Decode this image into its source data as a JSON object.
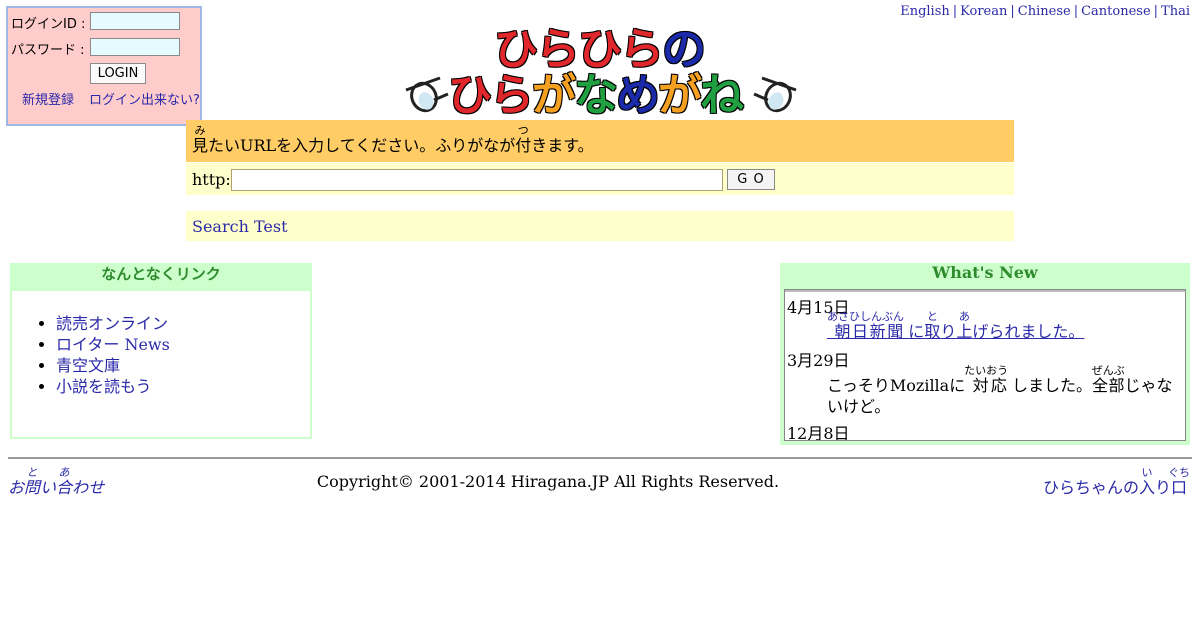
{
  "login": {
    "id_label": "ログインID :",
    "password_label": "パスワード :",
    "button_label": "LOGIN",
    "register_link": "新規登録",
    "forgot_link": "ログイン出来ない?"
  },
  "languages": [
    "English",
    "Korean",
    "Chinese",
    "Cantonese",
    "Thai"
  ],
  "logo": {
    "line1": "ひらひらの",
    "line2": "ひらがなめがね"
  },
  "url_panel": {
    "instruction_pre": "たいURLを入力してください。ふりがなが",
    "instruction_kanji1": "見",
    "instruction_ruby1": "み",
    "instruction_kanji2": "付",
    "instruction_ruby2": "つ",
    "instruction_post": "きます。",
    "prefix": "http://",
    "url_value": "",
    "go_label": "G O",
    "search_link": "Search Test"
  },
  "links_box": {
    "title": "なんとなくリンク",
    "items": [
      "読売オンライン",
      "ロイター News",
      "青空文庫",
      "小説を読もう"
    ]
  },
  "whats_new": {
    "title": "What's New",
    "entries": [
      {
        "date": "4月15日",
        "text_kanji1": "朝日新聞",
        "ruby1": "あさひしんぶん",
        "text_mid": "に",
        "text_kanji2": "取",
        "ruby2": "と",
        "text_mid2": "り",
        "text_kanji3": "上",
        "ruby3": "あ",
        "text_post": "げられました。"
      },
      {
        "date": "3月29日",
        "text_pre": "こっそりMozillaに",
        "text_kanji1": "対応",
        "ruby1": "たいおう",
        "text_mid": "しました。",
        "text_kanji2": "全部",
        "ruby2": "ぜんぶ",
        "text_post": "じゃないけど。"
      },
      {
        "date": "12月8日"
      }
    ]
  },
  "footer": {
    "contact_pre": "お",
    "contact_kanji1": "問",
    "contact_ruby1": "と",
    "contact_mid": "い",
    "contact_kanji2": "合",
    "contact_ruby2": "あ",
    "contact_post": "わせ",
    "copyright": "Copyright© 2001-2014 Hiragana.JP All Rights Reserved.",
    "entrance_pre": "ひらちゃんの",
    "entrance_kanji1": "入",
    "entrance_ruby1": "い",
    "entrance_mid": "り",
    "entrance_kanji2": "口",
    "entrance_ruby2": "ぐち"
  },
  "colors": {
    "login_bg": "#ffcccc",
    "instruction_bg": "#ffcc66",
    "url_bg": "#ffffcc",
    "box_green": "#ccffcc",
    "link_blue": "#2a2aa8",
    "logo_red": "#e0282c",
    "logo_blue": "#1a2aa8",
    "logo_orange": "#f5a020",
    "logo_green": "#20a040"
  }
}
